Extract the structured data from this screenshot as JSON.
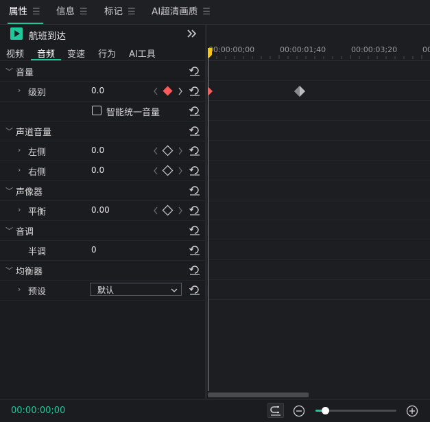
{
  "tabs": [
    {
      "label": "属性",
      "active": true
    },
    {
      "label": "信息",
      "active": false
    },
    {
      "label": "标记",
      "active": false
    },
    {
      "label": "AI超清画质",
      "active": false
    }
  ],
  "clip": {
    "title": "航班到达"
  },
  "subtabs": [
    {
      "label": "视频",
      "active": false
    },
    {
      "label": "音频",
      "active": true
    },
    {
      "label": "变速",
      "active": false
    },
    {
      "label": "行为",
      "active": false
    },
    {
      "label": "AI工具",
      "active": false
    }
  ],
  "sections": {
    "volume": {
      "title": "音量",
      "level_label": "级别",
      "level_value": "0.0",
      "normalize_label": "智能统一音量"
    },
    "channel": {
      "title": "声道音量",
      "left_label": "左侧",
      "left_value": "0.0",
      "right_label": "右侧",
      "right_value": "0.0"
    },
    "panner": {
      "title": "声像器",
      "balance_label": "平衡",
      "balance_value": "0.00"
    },
    "pitch": {
      "title": "音调",
      "semitone_label": "半调",
      "semitone_value": "0"
    },
    "equalizer": {
      "title": "均衡器",
      "preset_label": "预设",
      "preset_value": "默认"
    }
  },
  "timeline": {
    "ticks": [
      "00:00:00;00",
      "00:00:01;40",
      "00:00:03;20",
      "00:0"
    ]
  },
  "footer": {
    "timecode": "00:00:00;00",
    "zoom_level": 0.12
  },
  "colors": {
    "accent": "#1ec89a",
    "keyframe_active": "#ff5a5a",
    "playhead": "#f5c518"
  }
}
